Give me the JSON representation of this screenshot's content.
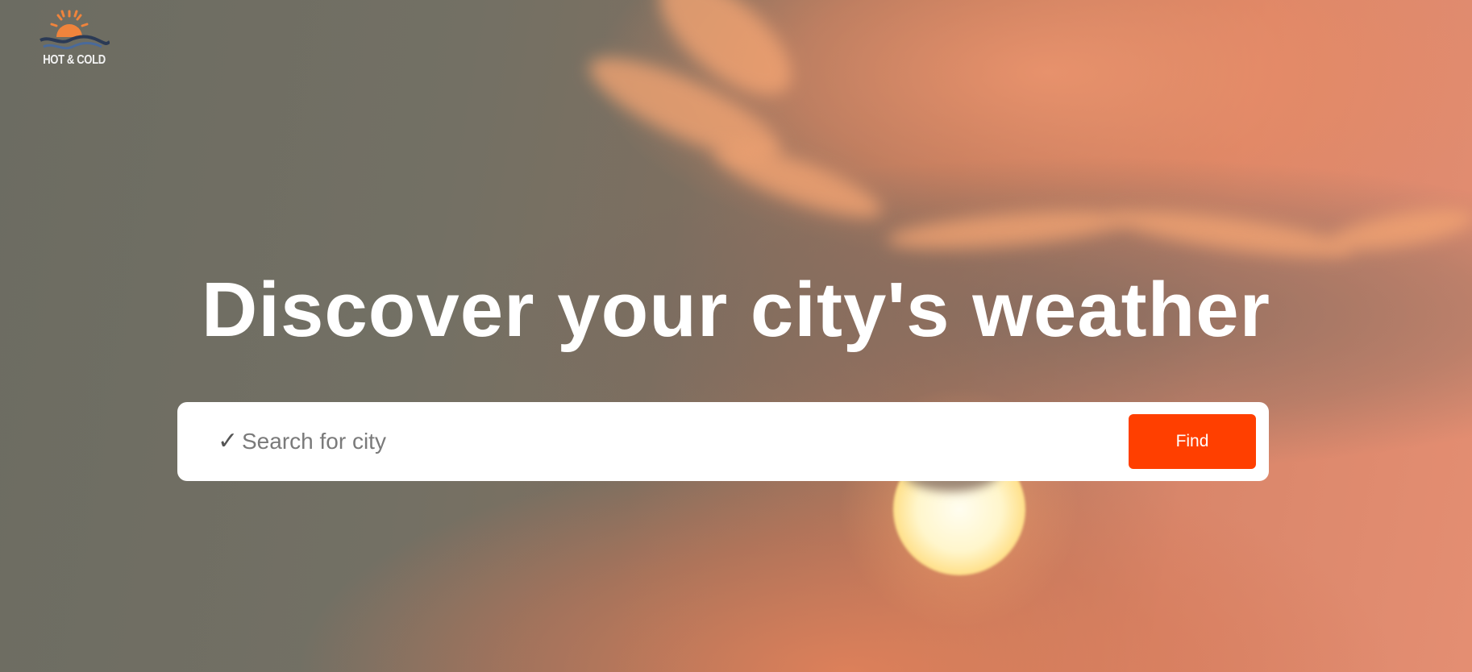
{
  "brand": {
    "name": "HOT & COLD",
    "logo_icon": "sun-over-waves-icon",
    "colors": {
      "sun": "#f0843c",
      "wave_dark": "#2b3a55",
      "wave_light": "#4a6a9a"
    }
  },
  "hero": {
    "headline": "Discover your city's weather",
    "background": "sunset-sky-with-clouds"
  },
  "search": {
    "check_icon": "✓",
    "placeholder": "Search for city",
    "value": "",
    "button_label": "Find"
  },
  "colors": {
    "accent": "#ff3f00",
    "headline": "#ffffff",
    "search_bg": "#ffffff"
  }
}
